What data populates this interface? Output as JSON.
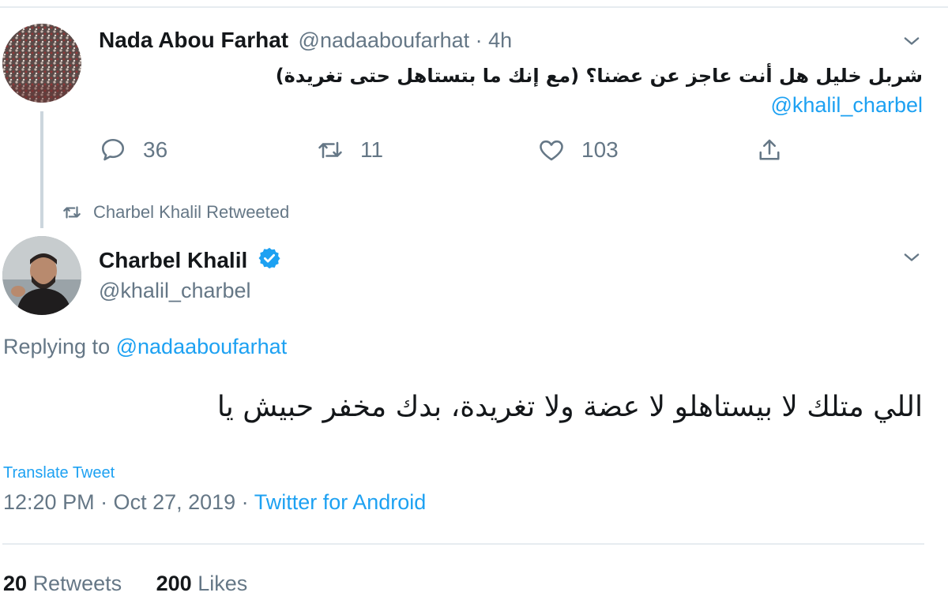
{
  "parent_tweet": {
    "author_name": "Nada Abou Farhat",
    "handle_time": "@nadaaboufarhat · 4h",
    "text": "شربل خليل هل أنت عاجز عن عضنا؟ (مع إنك ما بتستاهل حتى تغريدة)",
    "mention": "@khalil_charbel",
    "replies": "36",
    "retweets": "11",
    "likes": "103"
  },
  "retweet_context": "Charbel Khalil Retweeted",
  "main_tweet": {
    "author_name": "Charbel Khalil",
    "handle": "@khalil_charbel",
    "replying_label": "Replying to",
    "replying_handle": "@nadaaboufarhat",
    "text": "اللي متلك لا بيستاهلو لا عضة ولا تغريدة، بدك مخفر حبيش يا",
    "translate_label": "Translate Tweet",
    "timestamp": "12:20 PM · Oct 27, 2019 ·",
    "client": "Twitter for Android",
    "retweets_count": "20",
    "retweets_label": "Retweets",
    "likes_count": "200",
    "likes_label": "Likes"
  },
  "icons": {
    "reply": "reply-icon",
    "retweet": "retweet-icon",
    "like": "heart-icon",
    "share": "share-icon",
    "caret": "chevron-down-icon",
    "verified": "verified-badge-icon"
  },
  "colors": {
    "link": "#1da1f2",
    "muted": "#657786",
    "text": "#14171a"
  }
}
